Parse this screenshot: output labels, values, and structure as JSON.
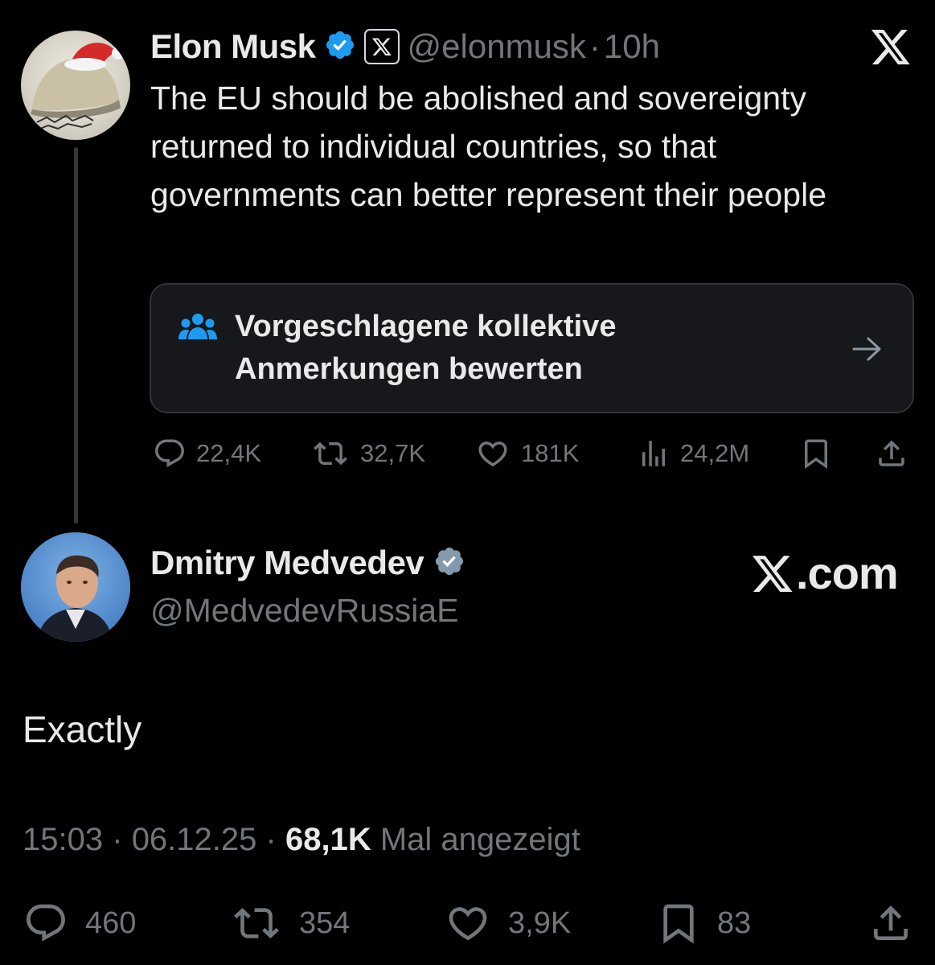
{
  "tweet1": {
    "author_name": "Elon Musk",
    "handle": "@elonmusk",
    "separator": "·",
    "time": "10h",
    "text": "The EU should be abolished and sovereignty returned to individual countries, so that governments can better represent their people",
    "verified_color": "#1d9bf0",
    "community_notes": {
      "label": "Vorgeschlagene kollektive Anmerkungen bewerten",
      "icon": "people-icon",
      "icon_color": "#1d9bf0"
    },
    "actions": {
      "replies": "22,4K",
      "reposts": "32,7K",
      "likes": "181K",
      "views": "24,2M"
    }
  },
  "tweet2": {
    "author_name": "Dmitry Medvedev",
    "handle": "@MedvedevRussiaE",
    "text": "Exactly",
    "watermark": ".com",
    "meta": {
      "time": "15:03",
      "sep1": "·",
      "date": "06.12.25",
      "sep2": "·",
      "views_count": "68,1K",
      "views_label": "Mal angezeigt"
    },
    "actions": {
      "replies": "460",
      "reposts": "354",
      "likes": "3,9K",
      "bookmarks": "83"
    }
  }
}
